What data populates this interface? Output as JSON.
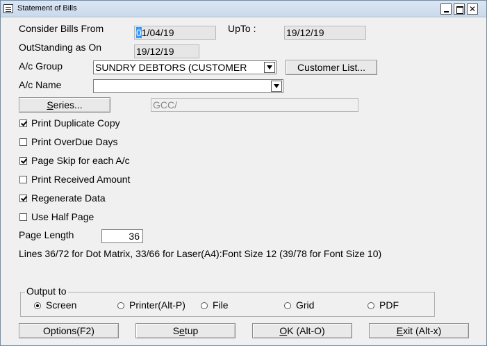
{
  "window": {
    "title": "Statement of Bills"
  },
  "dates": {
    "consider_label": "Consider Bills From",
    "from_value": "01/04/19",
    "from_value_first": "0",
    "from_value_rest": "1/04/19",
    "upto_label": "UpTo :",
    "upto_value": "19/12/19",
    "outstanding_label": "OutStanding as On",
    "outstanding_value": "19/12/19"
  },
  "ac_group": {
    "label": "A/c Group",
    "value": "SUNDRY DEBTORS (CUSTOMER"
  },
  "customer_list_button": "Customer List...",
  "ac_name": {
    "label": "A/c Name",
    "value": ""
  },
  "series": {
    "button_label": "Series...",
    "value": "GCC/"
  },
  "options": [
    {
      "label": "Print Duplicate Copy",
      "checked": true
    },
    {
      "label": "Print OverDue Days",
      "checked": false
    },
    {
      "label": "Page Skip for each A/c",
      "checked": true
    },
    {
      "label": "Print Received Amount",
      "checked": false
    },
    {
      "label": "Regenerate Data",
      "checked": true
    },
    {
      "label": "Use Half Page",
      "checked": false
    }
  ],
  "page_length": {
    "label": "Page Length",
    "value": "36"
  },
  "info_text": "Lines 36/72 for Dot Matrix, 33/66 for Laser(A4):Font Size 12 (39/78 for Font Size 10)",
  "output": {
    "legend": "Output to",
    "options": [
      {
        "label": "Screen",
        "selected": true
      },
      {
        "label": "Printer(Alt-P)",
        "selected": false
      },
      {
        "label": "File",
        "selected": false
      },
      {
        "label": "Grid",
        "selected": false
      },
      {
        "label": "PDF",
        "selected": false
      }
    ]
  },
  "buttons": {
    "options": "Options(F2)",
    "setup_pre": "S",
    "setup_u": "e",
    "setup_post": "tup",
    "ok_u": "O",
    "ok_post": "K (Alt-O)",
    "exit_u": "E",
    "exit_post": "xit (Alt-x)",
    "series_u": "S",
    "series_post": "eries..."
  }
}
